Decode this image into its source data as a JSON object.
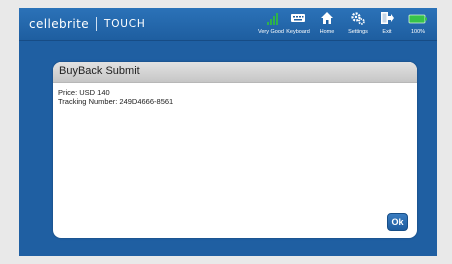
{
  "app": {
    "brand_name": "cellebrite",
    "brand_sub": "TOUCH"
  },
  "toolbar": {
    "items": [
      {
        "label": "Very Good",
        "icon": "signal-icon"
      },
      {
        "label": "Keyboard",
        "icon": "keyboard-icon"
      },
      {
        "label": "Home",
        "icon": "home-icon"
      },
      {
        "label": "Settings",
        "icon": "settings-icon"
      },
      {
        "label": "Exit",
        "icon": "exit-icon"
      },
      {
        "label": "100%",
        "icon": "battery-icon"
      }
    ]
  },
  "dialog": {
    "title": "BuyBack Submit",
    "lines": [
      "Price: USD 140",
      "Tracking Number: 249D4666-8561"
    ],
    "ok_label": "Ok"
  },
  "colors": {
    "screen_background": "#1f5fa2",
    "battery": "#37c24a",
    "signal": "#2fb24a"
  }
}
